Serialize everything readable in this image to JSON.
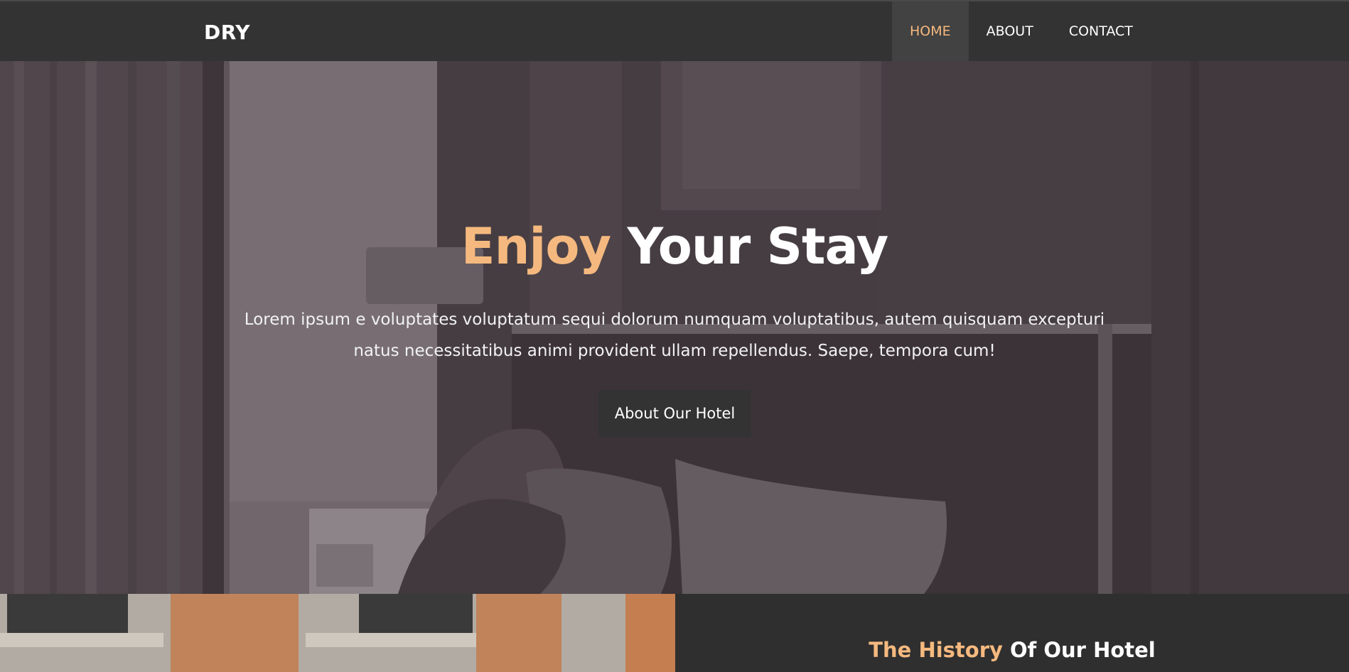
{
  "navbar": {
    "brand": "DRY",
    "items": [
      {
        "label": "HOME",
        "active": true
      },
      {
        "label": "ABOUT",
        "active": false
      },
      {
        "label": "CONTACT",
        "active": false
      }
    ]
  },
  "hero": {
    "title_accent": "Enjoy",
    "title_rest": "Your Stay",
    "text": "Lorem ipsum e voluptates voluptatum sequi dolorum numquam voluptatibus, autem quisquam excepturi natus necessitatibus animi provident ullam repellendus. Saepe, tempora cum!",
    "button_label": "About Our Hotel"
  },
  "history": {
    "title_accent": "The History",
    "title_rest": "Of Our Hotel"
  },
  "colors": {
    "accent": "#f5b97f",
    "navbar_bg": "#333333",
    "overlay": "#4c4449"
  }
}
